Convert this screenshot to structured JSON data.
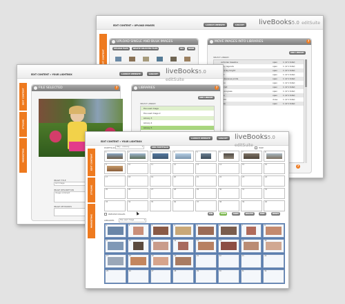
{
  "colors": {
    "accent_orange": "#ee7a1f",
    "panel_header_grey": "#8a8a8a",
    "library_border_blue": "#7d95b8",
    "list_highlight_green": "#c9e7a8"
  },
  "back_window": {
    "breadcrumb": "EDIT CONTENT » UPLOAD IMAGES",
    "buttons": [
      "LAUNCH WEBSITE",
      "LOGOUT"
    ],
    "logo": {
      "brand": "liveBooks",
      "version": "5.0",
      "suite": "editSuite"
    },
    "side_tabs": [
      "EDIT CONTENT"
    ],
    "upload_panel": {
      "title": "UPLOAD SINGLE AND BULK IMAGES",
      "buttons": [
        "UPLOAD FILES",
        "DELETE SELECTED FILES",
        "ALL",
        "NONE"
      ]
    },
    "move_panel": {
      "title": "MOVE IMAGES INTO LIBRARIES",
      "add_button": "ADD LIBRARY",
      "select_label": "SELECT LIBRARY",
      "rows": [
        {
          "name": "victorian baseline",
          "status": "open",
          "count": "1 (of 1 total)"
        },
        {
          "name": "baby legends",
          "status": "open",
          "count": "1 (of 1 total)"
        },
        {
          "name": "blue sky bright",
          "status": "open",
          "count": "1 (of 1 total)"
        },
        {
          "name": "wiki",
          "status": "open",
          "count": "1 (of 1 total)"
        },
        {
          "name": "backscenes prints",
          "status": "open",
          "count": "1 (of 1 total)"
        },
        {
          "name": "neon",
          "status": "open",
          "count": "1 (of 1 total)"
        },
        {
          "name": "patriot",
          "status": "open",
          "count": "1 (of 1 total)"
        },
        {
          "name": "tin progress",
          "status": "open",
          "count": "1 (of 1 total)"
        },
        {
          "name": "kids",
          "status": "open",
          "count": "1 (of 1 total)"
        },
        {
          "name": "5 FPV",
          "status": "close",
          "count": "1 (of 1 total)"
        },
        {
          "name": "kites",
          "status": "open",
          "count": "1 (of 1 total)"
        }
      ]
    }
  },
  "middle_window": {
    "breadcrumb": "EDIT CONTENT » YOUR LIGHTBOX",
    "buttons": [
      "LAUNCH WEBSITE",
      "LOGOUT"
    ],
    "logo": {
      "brand": "liveBooks",
      "version": "5.0",
      "suite": "editSuite"
    },
    "side_tabs": [
      "EDIT CONTENT",
      "STYLING",
      "MARKETING"
    ],
    "file_panel": {
      "title": "FILE SELECTED",
      "fields": [
        {
          "label": "IMAGE TITLE",
          "value": "Girl image"
        },
        {
          "label": "IMAGE DESCRIPTION",
          "value": "Image comment"
        },
        {
          "label": "IMAGE KEYWORDS",
          "value": ""
        }
      ]
    },
    "libraries_panel": {
      "title": "LIBRARIES",
      "add_button": "ADD LIBRARY",
      "select_label": "SELECT LIBRARY",
      "items": [
        "the used image",
        "the used image 2",
        "Library 3",
        "Library 4",
        "Library 5"
      ]
    }
  },
  "front_window": {
    "breadcrumb": "EDIT CONTENT » YOUR LIGHTBOX",
    "buttons": [
      "LAUNCH WEBSITE",
      "LOGOUT"
    ],
    "logo": {
      "brand": "liveBooks",
      "version": "5.0",
      "suite": "editSuite"
    },
    "side_tabs": [
      "EDIT CONTENT",
      "STYLING",
      "MARKETING"
    ],
    "portfolios_label": "PORTFOLIOS",
    "portfolio_selected": "Italy - scenery",
    "add_portfolio_button": "ADD PORTFOLIO",
    "hide_label": "HIDE",
    "preview_label": "PREVIEW IMAGES",
    "libraries_label": "LIBRARIES",
    "library_selected": "the used image",
    "action_buttons": [
      "PIN",
      "SAVE",
      "SORT",
      "DELETE",
      "EDIT",
      "RESET"
    ],
    "top_grid_numbers": [
      "1",
      "2",
      "3",
      "4",
      "5",
      "6",
      "7",
      "8",
      "9",
      "10",
      "11",
      "12",
      "13",
      "14",
      "15",
      "16",
      "17",
      "18",
      "19",
      "20",
      "21",
      "22",
      "23",
      "24",
      "25",
      "26",
      "27",
      "28",
      "29",
      "30",
      "31",
      "32",
      "33",
      "34",
      "35",
      "36",
      "37",
      "38",
      "39",
      "40"
    ],
    "bottom_grid_numbers": [
      "1",
      "2",
      "3",
      "4",
      "5",
      "6",
      "7",
      "8",
      "9",
      "10",
      "11",
      "12",
      "13",
      "14",
      "15",
      "16",
      "17",
      "18",
      "19",
      "20",
      "21",
      "22",
      "23",
      "24",
      "25",
      "26",
      "27",
      "28",
      "29",
      "30",
      "31",
      "32",
      "33",
      "34",
      "35",
      "36",
      "37",
      "38",
      "39",
      "40"
    ]
  }
}
